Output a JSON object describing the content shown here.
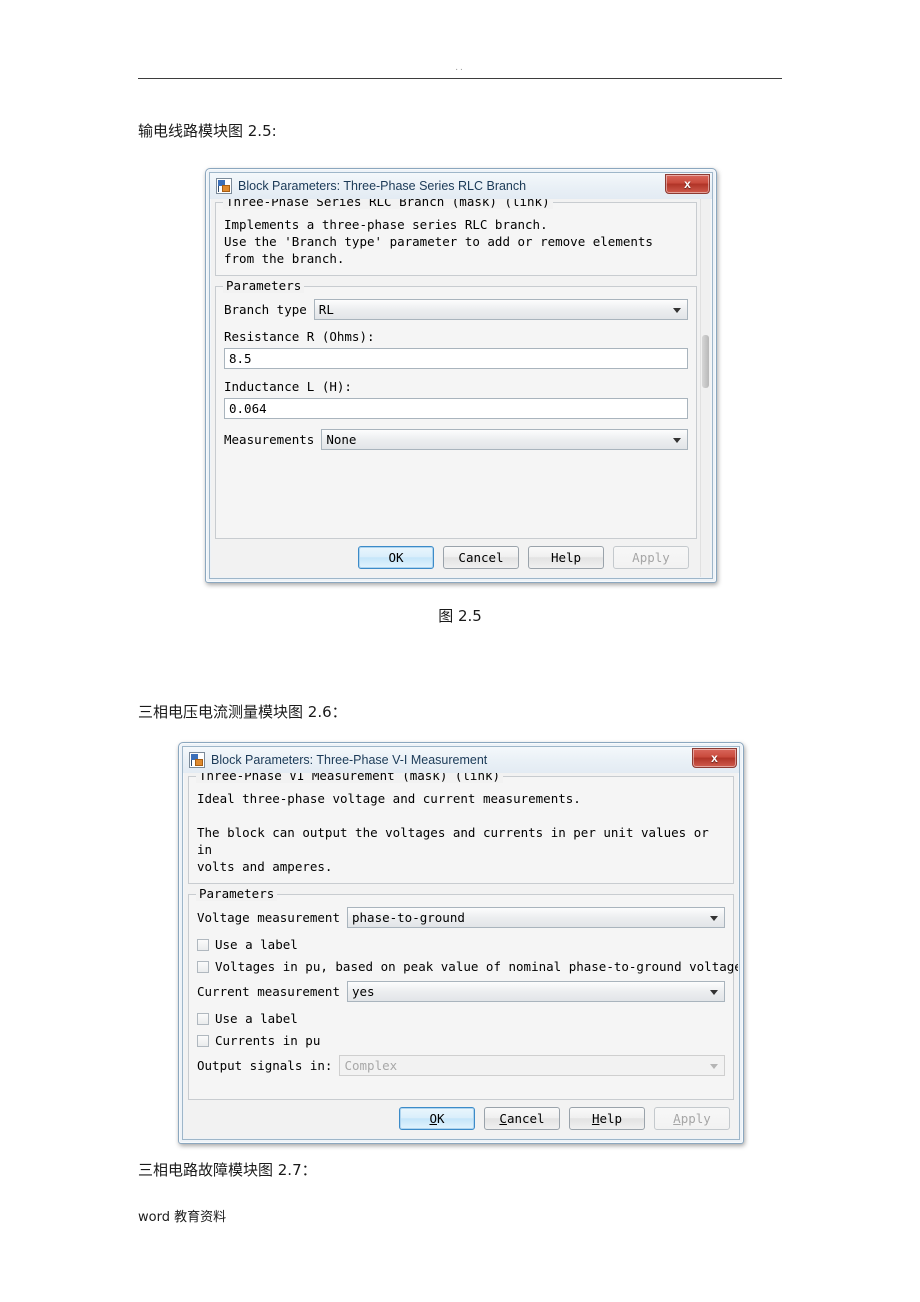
{
  "header": {
    "text": ".."
  },
  "document": {
    "line_before_fig25": "输电线路模块图 2.5:",
    "caption_fig25": "图 2.5",
    "line_before_fig26": "三相电压电流测量模块图 2.6：",
    "line_before_fig27": "三相电路故障模块图 2.7：",
    "footer": "word 教育资料"
  },
  "dialog_rlc": {
    "title": "Block Parameters: Three-Phase Series RLC Branch",
    "icon": "simulink-block-icon",
    "close_label": "x",
    "desc_title": "Three-Phase Series RLC Branch (mask) (link)",
    "desc_body": "Implements a three-phase series RLC branch.\nUse the 'Branch type' parameter to add or remove elements\nfrom the branch.",
    "params_title": "Parameters",
    "branch_type": {
      "label": "Branch type",
      "value": "RL"
    },
    "resistance": {
      "label": "Resistance R (Ohms):",
      "value": "8.5"
    },
    "inductance": {
      "label": "Inductance L (H):",
      "value": "0.064"
    },
    "measurements": {
      "label": "Measurements",
      "value": "None"
    },
    "buttons": {
      "ok": "OK",
      "cancel": "Cancel",
      "help": "Help",
      "apply": "Apply"
    }
  },
  "dialog_vi": {
    "title": "Block Parameters: Three-Phase V-I Measurement",
    "icon": "simulink-block-icon",
    "close_label": "x",
    "desc_title": "Three-Phase VI Measurement (mask) (link)",
    "desc_body": "Ideal three-phase voltage and current measurements.\n\nThe block can output the voltages and currents in per unit values or in\nvolts and amperes.",
    "params_title": "Parameters",
    "voltage_measurement": {
      "label": "Voltage measurement",
      "value": "phase-to-ground"
    },
    "use_a_label_v": "Use a label",
    "voltages_in_pu": "Voltages in pu,   based on peak value of nominal phase-to-ground voltage",
    "current_measurement": {
      "label": "Current measurement",
      "value": "yes"
    },
    "use_a_label_i": "Use a label",
    "currents_in_pu": "Currents in pu",
    "output_signals": {
      "label": "Output signals in:",
      "value": "Complex"
    },
    "buttons": {
      "ok_pre": "O",
      "ok_mnemonic": "K",
      "ok": "OK",
      "cancel_mnemonic": "C",
      "cancel_rest": "ancel",
      "help_mnemonic": "H",
      "help_rest": "elp",
      "apply_mnemonic": "A",
      "apply_rest": "pply"
    }
  }
}
